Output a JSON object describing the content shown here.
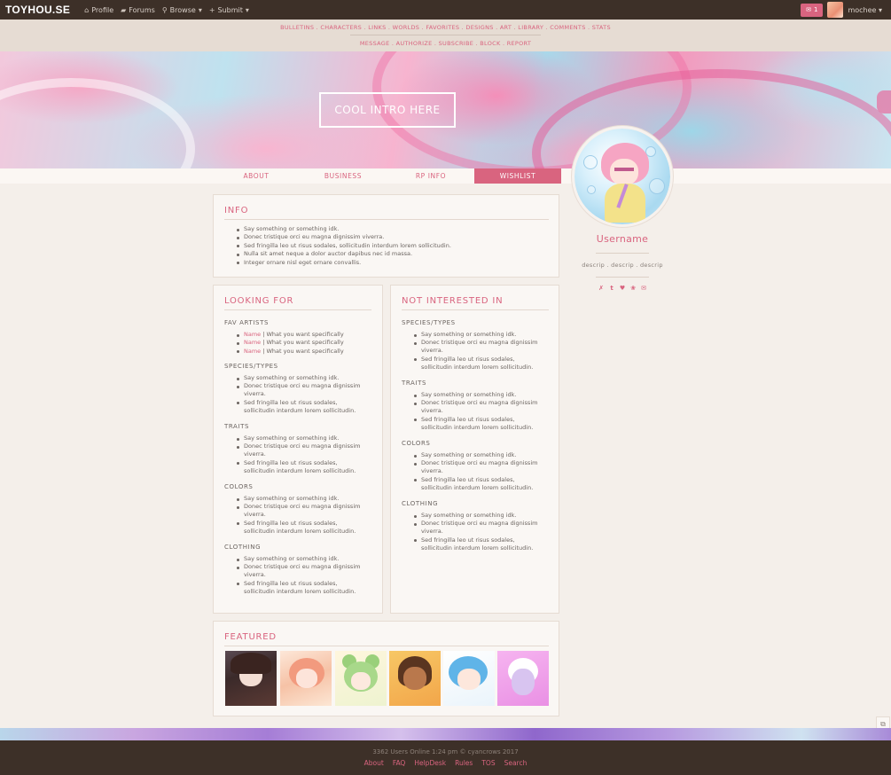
{
  "navbar": {
    "brand": "TOYHOU.SE",
    "items": [
      {
        "label": "Profile",
        "icon": "home-icon"
      },
      {
        "label": "Forums",
        "icon": "comments-icon"
      },
      {
        "label": "Browse",
        "icon": "search-icon"
      },
      {
        "label": "Submit",
        "icon": "plus-icon"
      }
    ],
    "message_count": "1",
    "username": "mochee"
  },
  "subnav": {
    "row1": [
      "BULLETINS",
      "CHARACTERS",
      "LINKS",
      "WORLDS",
      "FAVORITES",
      "DESIGNS",
      "ART",
      "LIBRARY",
      "COMMENTS",
      "STATS"
    ],
    "row2": [
      "MESSAGE",
      "AUTHORIZE",
      "SUBSCRIBE",
      "BLOCK",
      "REPORT"
    ],
    "separator": "."
  },
  "banner": {
    "intro": "COOL INTRO HERE"
  },
  "tabs": [
    "ABOUT",
    "BUSINESS",
    "RP INFO",
    "WISHLIST"
  ],
  "profile": {
    "username": "Username",
    "descrip": "descrip . descrip . descrip"
  },
  "info": {
    "title": "INFO",
    "items": [
      "Say something or something idk.",
      "Donec tristique orci eu magna dignissim viverra.",
      "Sed fringilla leo ut risus sodales, sollicitudin interdum lorem sollicitudin.",
      "Nulla sit amet neque a dolor auctor dapibus nec id massa.",
      "Integer ornare nisl eget ornare convallis."
    ]
  },
  "looking_for": {
    "title": "LOOKING FOR",
    "fav_artists_heading": "FAV ARTISTS",
    "fav_artists": [
      {
        "name": "Name",
        "text": " | What you want specifically"
      },
      {
        "name": "Name",
        "text": " | What you want specifically"
      },
      {
        "name": "Name",
        "text": " | What you want specifically"
      }
    ],
    "sections": [
      {
        "heading": "SPECIES/TYPES",
        "items": [
          "Say something or something idk.",
          "Donec tristique orci eu magna dignissim",
          "viverra.",
          "Sed fringilla leo ut risus sodales,",
          "sollicitudin interdum lorem sollicitudin."
        ]
      },
      {
        "heading": "TRAITS",
        "items": [
          "Say something or something idk.",
          "Donec tristique orci eu magna dignissim",
          "viverra.",
          "Sed fringilla leo ut risus sodales,",
          "sollicitudin interdum lorem sollicitudin."
        ]
      },
      {
        "heading": "COLORS",
        "items": [
          "Say something or something idk.",
          "Donec tristique orci eu magna dignissim",
          "viverra.",
          "Sed fringilla leo ut risus sodales,",
          "sollicitudin interdum lorem sollicitudin."
        ]
      },
      {
        "heading": "CLOTHING",
        "items": [
          "Say something or something idk.",
          "Donec tristique orci eu magna dignissim",
          "viverra.",
          "Sed fringilla leo ut risus sodales,",
          "sollicitudin interdum lorem sollicitudin."
        ]
      }
    ]
  },
  "not_interested": {
    "title": "NOT INTERESTED IN",
    "sections": [
      {
        "heading": "SPECIES/TYPES",
        "items": [
          "Say something or something idk.",
          "Donec tristique orci eu magna dignissim",
          "viverra.",
          "Sed fringilla leo ut risus sodales,",
          "sollicitudin interdum lorem sollicitudin."
        ]
      },
      {
        "heading": "TRAITS",
        "items": [
          "Say something or something idk.",
          "Donec tristique orci eu magna dignissim",
          "viverra.",
          "Sed fringilla leo ut risus sodales,",
          "sollicitudin interdum lorem sollicitudin."
        ]
      },
      {
        "heading": "COLORS",
        "items": [
          "Say something or something idk.",
          "Donec tristique orci eu magna dignissim",
          "viverra.",
          "Sed fringilla leo ut risus sodales,",
          "sollicitudin interdum lorem sollicitudin."
        ]
      },
      {
        "heading": "CLOTHING",
        "items": [
          "Say something or something idk.",
          "Donec tristique orci eu magna dignissim",
          "viverra.",
          "Sed fringilla leo ut risus sodales,",
          "sollicitudin interdum lorem sollicitudin."
        ]
      }
    ]
  },
  "featured": {
    "title": "FEATURED"
  },
  "footer": {
    "stats": "3362 Users Online   1:24 pm   © cyancrows 2017",
    "links": [
      "About",
      "FAQ",
      "HelpDesk",
      "Rules",
      "TOS",
      "Search"
    ]
  },
  "colors": {
    "accent": "#d9647f",
    "navbar": "#3d3028",
    "page_bg": "#f4efea"
  }
}
